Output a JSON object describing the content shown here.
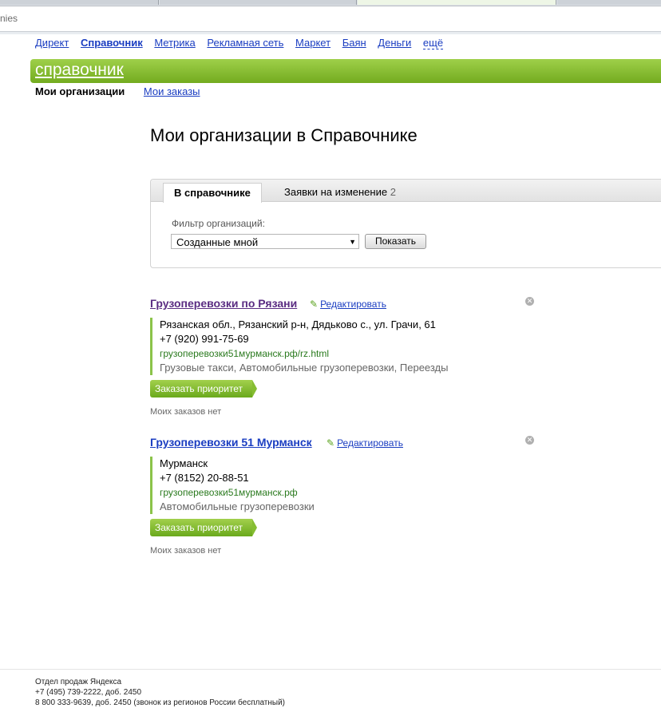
{
  "browser": {
    "address_partial": "nies"
  },
  "services": [
    {
      "label": "Директ"
    },
    {
      "label": "Справочник"
    },
    {
      "label": "Метрика"
    },
    {
      "label": "Рекламная сеть"
    },
    {
      "label": "Маркет"
    },
    {
      "label": "Баян"
    },
    {
      "label": "Деньги"
    },
    {
      "label": "ещё"
    }
  ],
  "brand": {
    "title": "справочник",
    "color": "#86bd33"
  },
  "subnav": {
    "active": "Мои организации",
    "link": "Мои заказы"
  },
  "page": {
    "title": "Мои организации в Справочнике"
  },
  "tabs": {
    "active": "В справочнике",
    "second_label": "Заявки на изменение",
    "second_count": "2"
  },
  "filter": {
    "label": "Фильтр организаций:",
    "selected": "Созданные мной",
    "button": "Показать"
  },
  "organizations": [
    {
      "name": "Грузоперевозки по Рязани",
      "edit": "Редактировать",
      "address": "Рязанская обл., Рязанский р-н, Дядьково с., ул. Грачи, 61",
      "phone": "+7 (920) 991-75-69",
      "url": "грузоперевозки51мурманск.рф/rz.html",
      "categories": "Грузовые такси, Автомобильные грузоперевозки, Переезды",
      "priority_button": "Заказать приоритет",
      "orders": "Моих заказов нет"
    },
    {
      "name": "Грузоперевозки 51 Мурманск",
      "edit": "Редактировать",
      "address": "Мурманск",
      "phone": "+7 (8152) 20-88-51",
      "url": "грузоперевозки51мурманск.рф",
      "categories": "Автомобильные грузоперевозки",
      "priority_button": "Заказать приоритет",
      "orders": "Моих заказов нет"
    }
  ],
  "footer": {
    "line1": "Отдел продаж Яндекса",
    "line2": "+7 (495) 739-2222, доб. 2450",
    "line3": "8 800 333-9639, доб. 2450 (звонок из регионов России бесплатный)"
  }
}
